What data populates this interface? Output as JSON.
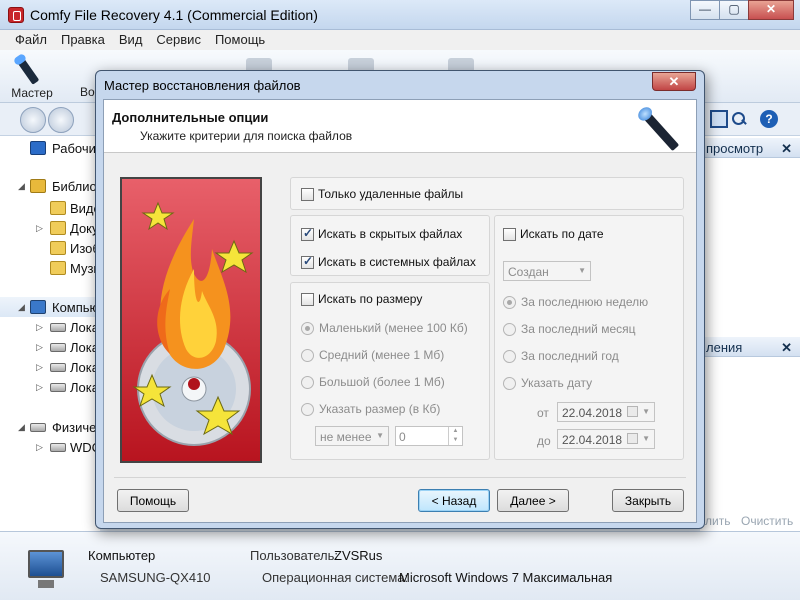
{
  "window": {
    "title": "Comfy File Recovery 4.1 (Commercial Edition)",
    "minimize": "—",
    "maximize": "▢",
    "close": "✕"
  },
  "menu": [
    "Файл",
    "Правка",
    "Вид",
    "Сервис",
    "Помощь"
  ],
  "ribbon": {
    "master_label": "Мастер",
    "partial_label": "Во"
  },
  "tree": {
    "desktop": "Рабочий стол",
    "libraries": "Библиотеки",
    "video": "Видео",
    "documents": "Документы",
    "images": "Изображения",
    "music": "Музыка",
    "computer": "Компьютер",
    "local1": "Локальный диск",
    "local2": "Локальный диск",
    "local3": "Локальный диск",
    "local4": "Локальный диск",
    "physical": "Физические диски",
    "wdc": "WDC"
  },
  "right_panel": {
    "preview_label": "просмотр",
    "recovery_label": "ления",
    "close_x": "✕",
    "link_apply": "лить",
    "link_clear": "Очистить"
  },
  "status": {
    "computer_label": "Компьютер",
    "computer_name": "SAMSUNG-QX410",
    "user_label": "Пользователь:",
    "user_value": "ZVSRus",
    "os_label": "Операционная система:",
    "os_value": "Microsoft Windows 7 Максимальная"
  },
  "dialog": {
    "title": "Мастер восстановления файлов",
    "close": "✕",
    "header_title": "Дополнительные опции",
    "header_subtitle": "Укажите критерии для поиска файлов",
    "deleted_only": "Только удаленные файлы",
    "search_hidden": "Искать в скрытых файлах",
    "search_system": "Искать в системных файлах",
    "search_by_size": "Искать по размеру",
    "size_small": "Маленький (менее 100 Кб)",
    "size_medium": "Средний (менее 1 Мб)",
    "size_large": "Большой (более 1 Мб)",
    "size_custom": "Указать размер (в Кб)",
    "size_mode": "не менее",
    "size_value": "0",
    "search_by_date": "Искать по дате",
    "date_type": "Создан",
    "date_last_week": "За последнюю неделю",
    "date_last_month": "За последний месяц",
    "date_last_year": "За последний год",
    "date_custom": "Указать дату",
    "from_label": "от",
    "to_label": "до",
    "from_date": "22.04.2018",
    "to_date": "22.04.2018",
    "btn_help": "Помощь",
    "btn_back": "< Назад",
    "btn_next": "Далее >",
    "btn_close": "Закрыть"
  },
  "colors": {
    "accent": "#3c7fb1",
    "close_red": "#c14545",
    "image_red": "#c41e2a"
  }
}
